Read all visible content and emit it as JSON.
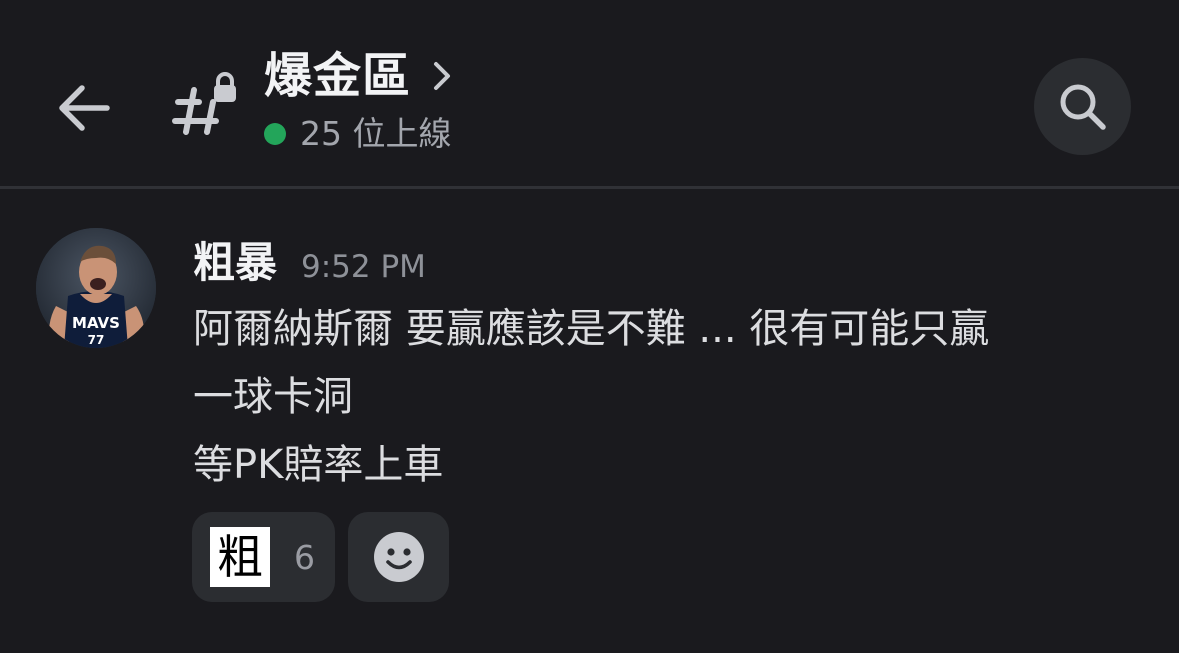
{
  "header": {
    "channel_name": "爆金區",
    "online_text": "25 位上線",
    "icons": {
      "back": "arrow-left-icon",
      "channel": "locked-text-channel-icon",
      "chevron": "chevron-right-icon",
      "search": "search-icon"
    },
    "status_color": "#23a55a"
  },
  "message": {
    "author": "粗暴",
    "timestamp": "9:52 PM",
    "avatar_icon": "avatar-basketball-player-mavs-jersey",
    "lines": [
      "阿爾納斯爾 要贏應該是不難 ... 很有可能只贏",
      "一球卡洞",
      "等PK賠率上車"
    ],
    "reactions": [
      {
        "emoji": "粗",
        "count": "6"
      }
    ],
    "add_reaction_icon": "add-reaction-smiley-icon"
  },
  "colors": {
    "background": "#1a1a1e",
    "surface": "#2b2d31",
    "text": "#dcdde0",
    "muted": "#8e9198"
  }
}
